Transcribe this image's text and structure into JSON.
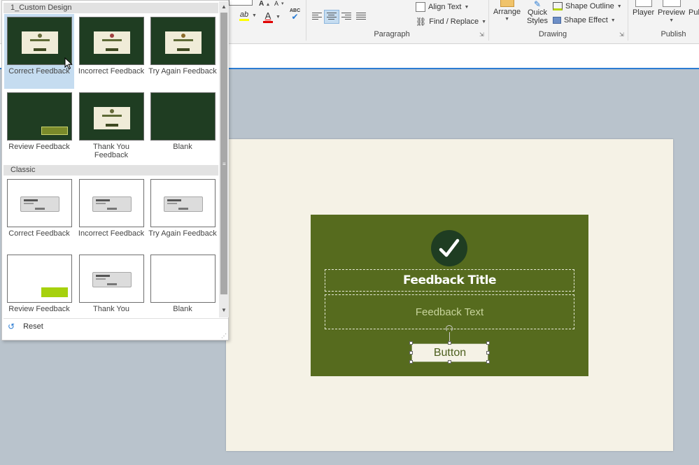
{
  "ribbon": {
    "align_text": "Align Text",
    "find_replace": "Find / Replace",
    "paragraph_label": "Paragraph",
    "arrange": "Arrange",
    "quick_styles": "Quick Styles",
    "shape_outline": "Shape Outline",
    "shape_effect": "Shape Effect",
    "drawing_label": "Drawing",
    "player": "Player",
    "preview": "Preview",
    "publish_partial": "Pub",
    "publish_label": "Publish",
    "abc": "ABC",
    "font_color_letter": "A",
    "highlight_letter": "ab"
  },
  "gallery": {
    "section_custom": "1_Custom Design",
    "section_classic": "Classic",
    "custom_tiles": [
      {
        "label": "Correct Feedback",
        "style": "dark-card",
        "selected": true
      },
      {
        "label": "Incorrect Feedback",
        "style": "dark-card",
        "selected": false
      },
      {
        "label": "Try Again Feedback",
        "style": "dark-card",
        "selected": false
      },
      {
        "label": "Review Feedback",
        "style": "dark-button",
        "selected": false
      },
      {
        "label": "Thank You Feedback",
        "style": "dark-card",
        "selected": false
      },
      {
        "label": "Blank",
        "style": "dark-blank",
        "selected": false
      }
    ],
    "classic_tiles": [
      {
        "label": "Correct Feedback",
        "style": "grey-card"
      },
      {
        "label": "Incorrect Feedback",
        "style": "grey-card"
      },
      {
        "label": "Try Again Feedback",
        "style": "grey-card"
      },
      {
        "label": "Review Feedback",
        "style": "lime-button"
      },
      {
        "label": "Thank You",
        "style": "grey-card"
      },
      {
        "label": "Blank",
        "style": "white-blank"
      }
    ],
    "reset": "Reset"
  },
  "slide": {
    "title": "Feedback Title",
    "text": "Feedback Text",
    "button": "Button"
  },
  "colors": {
    "slide_bg": "#f5f2e6",
    "card_bg": "#566b1e",
    "check_circle": "#1f3d22",
    "accent_blue": "#2b7cd3"
  }
}
